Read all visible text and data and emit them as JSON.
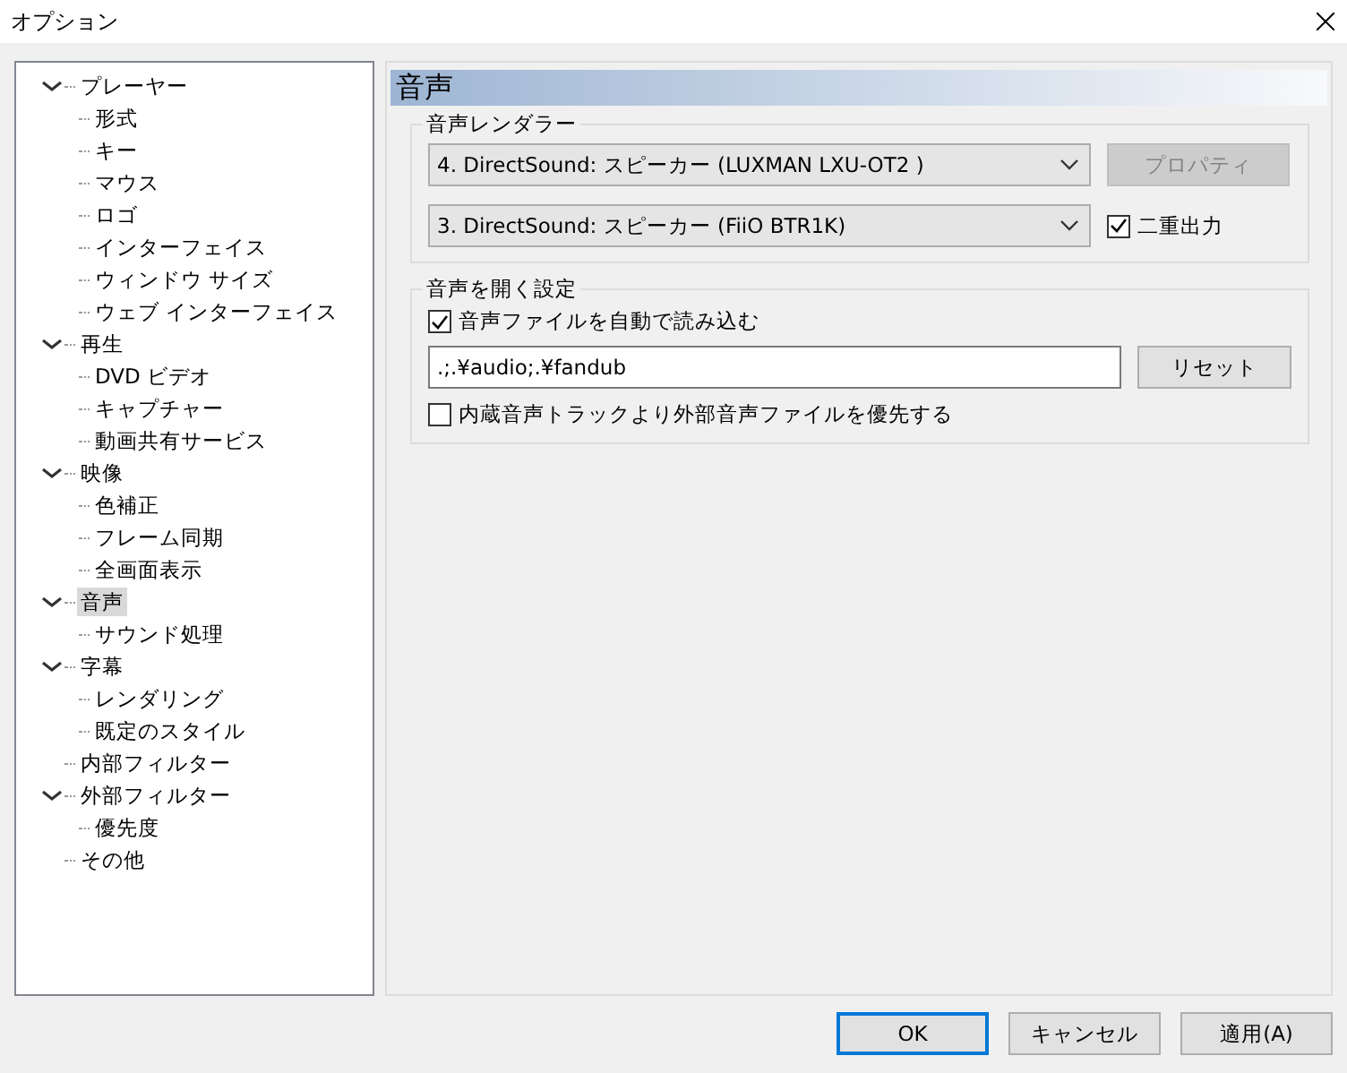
{
  "window": {
    "title": "オプション"
  },
  "tree": [
    {
      "label": "プレーヤー",
      "expanded": true,
      "selected": false,
      "children": [
        {
          "label": "形式",
          "selected": false
        },
        {
          "label": "キー",
          "selected": false
        },
        {
          "label": "マウス",
          "selected": false
        },
        {
          "label": "ロゴ",
          "selected": false
        },
        {
          "label": "インターフェイス",
          "selected": false
        },
        {
          "label": "ウィンドウ サイズ",
          "selected": false
        },
        {
          "label": "ウェブ インターフェイス",
          "selected": false
        }
      ]
    },
    {
      "label": "再生",
      "expanded": true,
      "selected": false,
      "children": [
        {
          "label": "DVD ビデオ",
          "selected": false
        },
        {
          "label": "キャプチャー",
          "selected": false
        },
        {
          "label": "動画共有サービス",
          "selected": false
        }
      ]
    },
    {
      "label": "映像",
      "expanded": true,
      "selected": false,
      "children": [
        {
          "label": "色補正",
          "selected": false
        },
        {
          "label": "フレーム同期",
          "selected": false
        },
        {
          "label": "全画面表示",
          "selected": false
        }
      ]
    },
    {
      "label": "音声",
      "expanded": true,
      "selected": true,
      "children": [
        {
          "label": "サウンド処理",
          "selected": false
        }
      ]
    },
    {
      "label": "字幕",
      "expanded": true,
      "selected": false,
      "children": [
        {
          "label": "レンダリング",
          "selected": false
        },
        {
          "label": "既定のスタイル",
          "selected": false
        }
      ]
    },
    {
      "label": "内部フィルター",
      "selected": false
    },
    {
      "label": "外部フィルター",
      "expanded": true,
      "selected": false,
      "children": [
        {
          "label": "優先度",
          "selected": false
        }
      ]
    },
    {
      "label": "その他",
      "selected": false
    }
  ],
  "page": {
    "heading": "音声",
    "renderer_group": {
      "title": "音声レンダラー",
      "primary_device": "4. DirectSound: スピーカー (LUXMAN LXU-OT2  )",
      "properties_button": {
        "label": "プロパティ",
        "disabled": true
      },
      "secondary_device": "3. DirectSound: スピーカー (FiiO BTR1K)",
      "dual_output": {
        "label": "二重出力",
        "checked": true
      }
    },
    "open_group": {
      "title": "音声を開く設定",
      "auto_load": {
        "label": "音声ファイルを自動で読み込む",
        "checked": true
      },
      "paths": ".;.¥audio;.¥fandub",
      "reset_button": "リセット",
      "prefer_external": {
        "label": "内蔵音声トラックより外部音声ファイルを優先する",
        "checked": false
      }
    }
  },
  "buttons": [
    {
      "label": "OK",
      "default": true
    },
    {
      "label": "キャンセル",
      "default": false
    },
    {
      "label": "適用(A)",
      "default": false
    }
  ]
}
